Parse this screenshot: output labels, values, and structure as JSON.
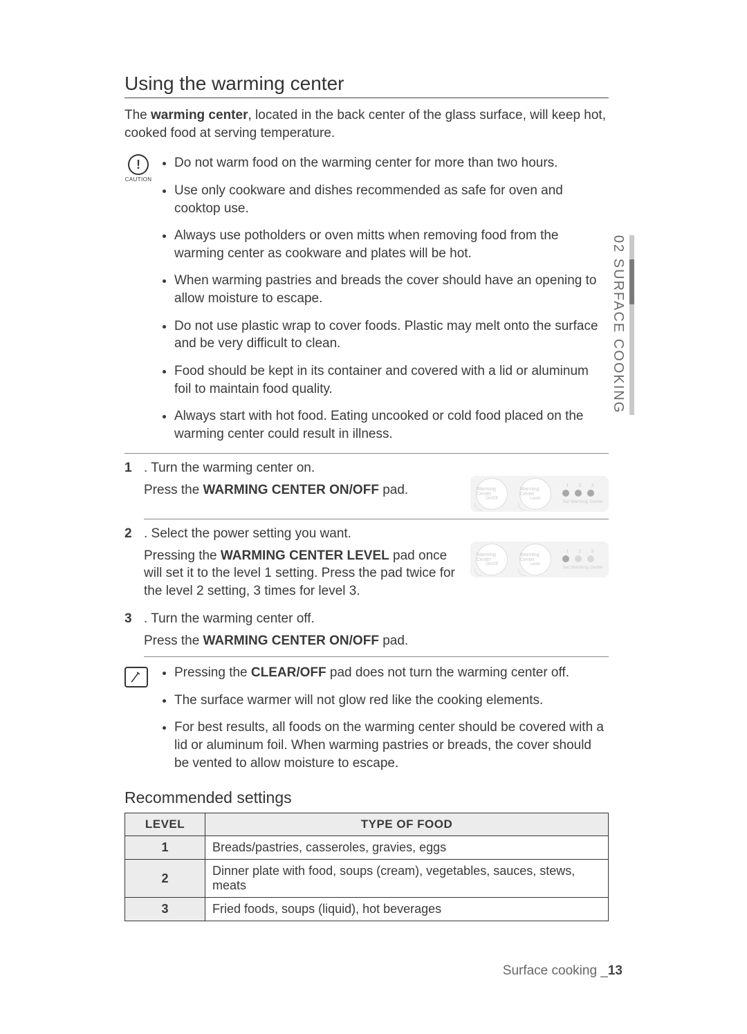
{
  "sideTab": "02  SURFACE COOKING",
  "heading": "Using the warming center",
  "intro": {
    "pre": "The ",
    "bold": "warming center",
    "post": ", located in the back center of the glass surface, will keep hot, cooked food at serving temperature."
  },
  "caution": {
    "iconLabel": "CAUTION",
    "iconGlyph": "!",
    "items": [
      "Do not warm food on the warming center for more than two hours.",
      "Use only cookware and dishes recommended as safe for oven and cooktop use.",
      "Always use potholders or oven mitts when removing food from the warming center as cookware and plates will be hot.",
      "When warming pastries and breads the cover should have an opening to allow moisture to escape.",
      "Do not use plastic wrap to cover foods. Plastic may melt onto the surface and be very difficult to clean.",
      "Food should be kept in its container and covered with a lid or aluminum foil to maintain food quality.",
      "Always start with hot food. Eating uncooked or cold food placed on the warming center could result in illness."
    ]
  },
  "steps": [
    {
      "num": "1",
      "title": ". Turn the warming center on.",
      "action_pre": "Press the ",
      "action_bold": "WARMING CENTER ON/OFF",
      "action_post": " pad.",
      "panel": {
        "btn1": "Warming Center",
        "sub1": "On/Off",
        "btn2": "Warming Center",
        "sub2": "Level",
        "label": "Set  Warming Center",
        "allOn": true
      }
    },
    {
      "num": "2",
      "title": ".  Select the power setting you want.",
      "action_pre": "Pressing the ",
      "action_bold": "WARMING CENTER LEVEL",
      "action_post": " pad once will set it to the level 1 setting. Press the pad twice for the level 2 setting, 3 times for level 3.",
      "panel": {
        "btn1": "Warming Center",
        "sub1": "On/Off",
        "btn2": "Warming Center",
        "sub2": "Level",
        "label": "Set  Warming Center",
        "allOn": false
      }
    },
    {
      "num": "3",
      "title": ".  Turn the warming center off.",
      "action_pre": "Press the ",
      "action_bold": "WARMING CENTER ON/OFF",
      "action_post": " pad.",
      "panel": null
    }
  ],
  "notes": [
    {
      "pre": "Pressing the ",
      "bold": "CLEAR/OFF",
      "post": " pad does not turn the warming center off."
    },
    {
      "pre": "",
      "bold": "",
      "post": "The surface warmer will not glow red like the cooking elements."
    },
    {
      "pre": "",
      "bold": "",
      "post": "For best results, all foods on the warming center should be covered with a lid or aluminum foil. When warming pastries or breads, the cover should be vented to allow moisture to escape."
    }
  ],
  "recommendedHeading": "Recommended settings",
  "table": {
    "headers": [
      "LEVEL",
      "TYPE OF FOOD"
    ],
    "rows": [
      {
        "level": "1",
        "food": "Breads/pastries, casseroles, gravies, eggs"
      },
      {
        "level": "2",
        "food": "Dinner plate with food, soups (cream), vegetables, sauces, stews, meats"
      },
      {
        "level": "3",
        "food": "Fried foods, soups (liquid), hot beverages"
      }
    ]
  },
  "footer": {
    "text": "Surface cooking _",
    "page": "13"
  }
}
